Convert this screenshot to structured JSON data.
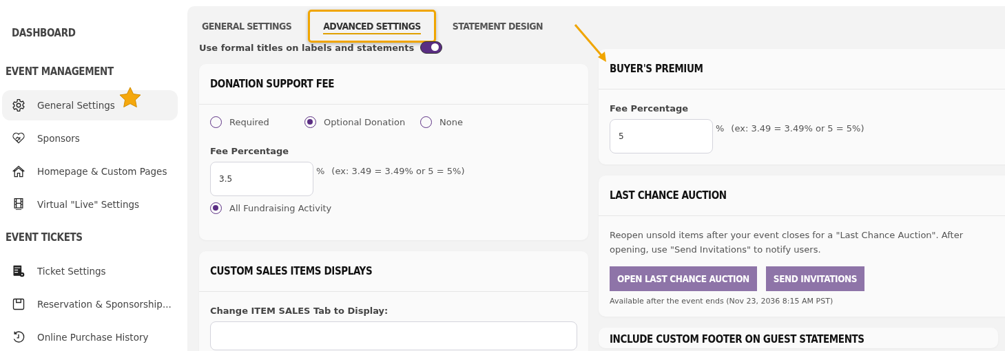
{
  "sidebar": {
    "sections": [
      {
        "title": "DASHBOARD"
      },
      {
        "title": "EVENT MANAGEMENT",
        "items": [
          {
            "label": "General Settings",
            "selected": true
          },
          {
            "label": "Sponsors",
            "selected": false
          },
          {
            "label": "Homepage & Custom Pages",
            "selected": false
          },
          {
            "label": "Virtual \"Live\" Settings",
            "selected": false
          }
        ]
      },
      {
        "title": "EVENT TICKETS",
        "items": [
          {
            "label": "Ticket Settings",
            "selected": false
          },
          {
            "label": "Reservation & Sponsorship...",
            "selected": false
          },
          {
            "label": "Online Purchase History",
            "selected": false
          }
        ]
      }
    ]
  },
  "tabs": [
    {
      "label": "GENERAL SETTINGS",
      "selected": false
    },
    {
      "label": "ADVANCED SETTINGS",
      "selected": true
    },
    {
      "label": "STATEMENT DESIGN",
      "selected": false
    }
  ],
  "formal_titles": {
    "label": "Use formal titles on labels and statements",
    "on": true
  },
  "donation_support_fee": {
    "title": "DONATION SUPPORT FEE",
    "options": [
      {
        "label": "Required",
        "selected": false
      },
      {
        "label": "Optional Donation",
        "selected": true
      },
      {
        "label": "None",
        "selected": false
      }
    ],
    "fee_label": "Fee Percentage",
    "fee_value": "3.5",
    "unit": "%",
    "hint": "(ex: 3.49 = 3.49% or 5 = 5%)",
    "scope": {
      "label": "All Fundraising Activity",
      "selected": true
    }
  },
  "custom_sales_items_displays": {
    "title": "CUSTOM SALES ITEMS DISPLAYS",
    "field_label": "Change ITEM SALES Tab to Display:"
  },
  "buyers_premium": {
    "title": "BUYER'S PREMIUM",
    "fee_label": "Fee Percentage",
    "fee_value": "5",
    "unit": "%",
    "hint": "(ex: 3.49 = 3.49% or 5 = 5%)"
  },
  "last_chance_auction": {
    "title": "LAST CHANCE AUCTION",
    "description": "Reopen unsold items after your event closes for a \"Last Chance Auction\". After opening, use \"Send Invitations\" to notify users.",
    "buttons": [
      "OPEN LAST CHANCE AUCTION",
      "SEND INVITATIONS"
    ],
    "note": "Available after the event ends (Nov 23, 2036 8:15 AM PST)"
  },
  "custom_footer": {
    "title": "INCLUDE CUSTOM FOOTER ON GUEST STATEMENTS"
  }
}
